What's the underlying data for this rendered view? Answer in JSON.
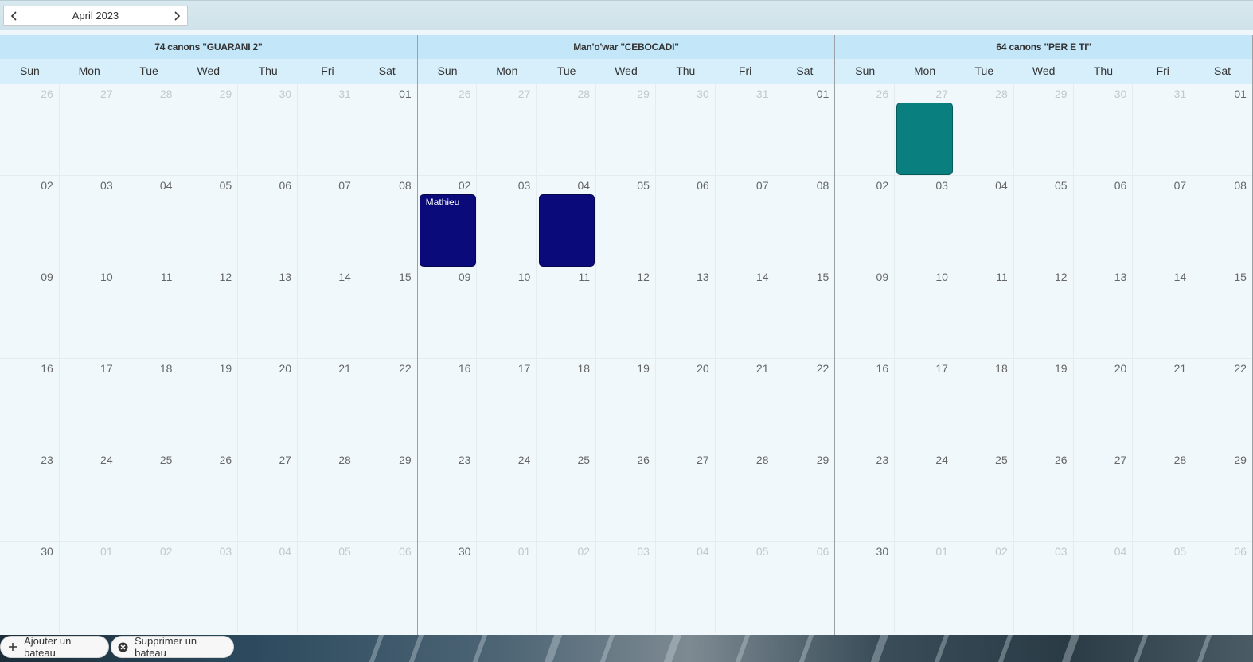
{
  "nav": {
    "prev_icon": "chevron-left-icon",
    "next_icon": "chevron-right-icon",
    "month_label": "April 2023"
  },
  "weekdays": [
    "Sun",
    "Mon",
    "Tue",
    "Wed",
    "Thu",
    "Fri",
    "Sat"
  ],
  "weeks": [
    [
      "26",
      "27",
      "28",
      "29",
      "30",
      "31",
      "01"
    ],
    [
      "02",
      "03",
      "04",
      "05",
      "06",
      "07",
      "08"
    ],
    [
      "09",
      "10",
      "11",
      "12",
      "13",
      "14",
      "15"
    ],
    [
      "16",
      "17",
      "18",
      "19",
      "20",
      "21",
      "22"
    ],
    [
      "23",
      "24",
      "25",
      "26",
      "27",
      "28",
      "29"
    ],
    [
      "30",
      "01",
      "02",
      "03",
      "04",
      "05",
      "06"
    ]
  ],
  "current_month_flags": [
    [
      false,
      false,
      false,
      false,
      false,
      false,
      true
    ],
    [
      true,
      true,
      true,
      true,
      true,
      true,
      true
    ],
    [
      true,
      true,
      true,
      true,
      true,
      true,
      true
    ],
    [
      true,
      true,
      true,
      true,
      true,
      true,
      true
    ],
    [
      true,
      true,
      true,
      true,
      true,
      true,
      true
    ],
    [
      true,
      false,
      false,
      false,
      false,
      false,
      false
    ]
  ],
  "boats": [
    {
      "title": "74 canons \"GUARANI 2\"",
      "events": []
    },
    {
      "title": "Man'o'war \"CEBOCADI\"",
      "events": [
        {
          "week": 1,
          "day": 0,
          "label": "Mathieu",
          "color": "#0a0a7a"
        },
        {
          "week": 1,
          "day": 2,
          "label": "",
          "color": "#0a0a7a"
        }
      ]
    },
    {
      "title": "64 canons \"PER E TI\"",
      "events": [
        {
          "week": 0,
          "day": 1,
          "label": "",
          "color": "#0a7f7f"
        }
      ]
    }
  ],
  "actions": {
    "add_label": "Ajouter un bateau",
    "add_icon": "plus-icon",
    "remove_label": "Supprimer un bateau",
    "remove_icon": "circle-x-icon"
  },
  "colors": {
    "header_bg": "#c4e6f9",
    "weekday_bg": "#d6effb",
    "event_navy": "#0a0a7a",
    "event_teal": "#0a7f7f"
  }
}
